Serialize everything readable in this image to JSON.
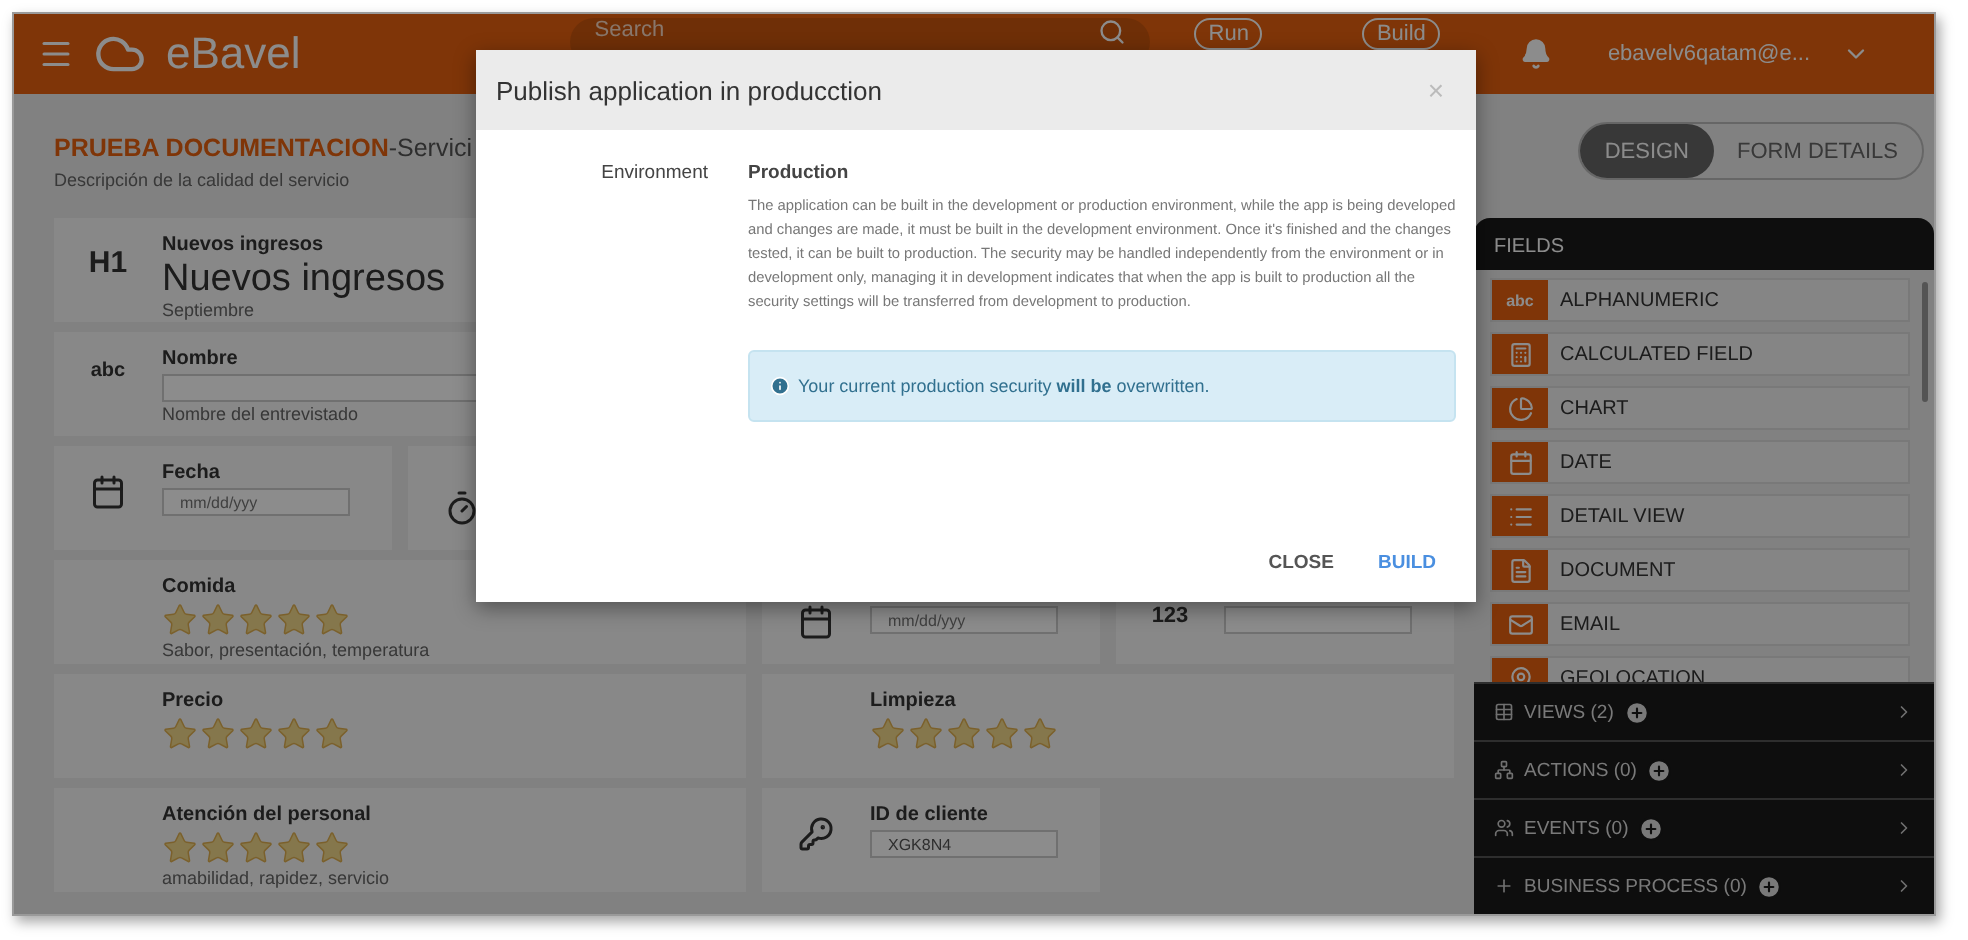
{
  "header": {
    "brand": "eBavel",
    "search": {
      "placeholder": "Search"
    },
    "buttons": [
      "Run",
      "Build"
    ],
    "user": "ebavelv6qatam@e..."
  },
  "form": {
    "title": "PRUEBA DOCUMENTACION",
    "title_suffix": "-Servici",
    "subtitle": "Descripción de la calidad del servicio",
    "fields": [
      {
        "kind": "heading",
        "label": "Nuevos ingresos",
        "value": "Nuevos ingresos",
        "hint": "Septiembre",
        "icon_text": "H1"
      },
      {
        "kind": "text",
        "label": "Nombre",
        "hint": "Nombre del entrevistado",
        "icon_text": "abc"
      },
      {
        "kind": "date",
        "label": "Fecha",
        "placeholder": "mm/dd/yyy"
      },
      {
        "kind": "time"
      },
      {
        "kind": "rating",
        "label": "Comida",
        "stars": 5,
        "hint": "Sabor, presentación, temperatura"
      },
      {
        "kind": "date",
        "placeholder": "mm/dd/yyy"
      },
      {
        "kind": "number",
        "icon_text": "123"
      },
      {
        "kind": "rating",
        "label": "Precio",
        "stars": 5
      },
      {
        "kind": "rating",
        "label": "Limpieza",
        "stars": 5
      },
      {
        "kind": "rating",
        "label": "Atención del personal",
        "stars": 5,
        "hint": "amabilidad, rapidez, servicio"
      },
      {
        "kind": "key",
        "label": "ID de cliente",
        "value": "XGK8N4"
      }
    ]
  },
  "view_tabs": [
    {
      "label": "DESIGN",
      "selected": true
    },
    {
      "label": "FORM DETAILS",
      "selected": false
    }
  ],
  "panel": {
    "title": "FIELDS",
    "field_types": [
      {
        "kind": "text",
        "label": "ALPHANUMERIC",
        "icon_text": "abc"
      },
      {
        "kind": "calculator",
        "label": "CALCULATED FIELD"
      },
      {
        "kind": "chart",
        "label": "CHART"
      },
      {
        "kind": "date",
        "label": "DATE"
      },
      {
        "kind": "detail",
        "label": "DETAIL VIEW"
      },
      {
        "kind": "document",
        "label": "DOCUMENT"
      },
      {
        "kind": "email",
        "label": "EMAIL"
      },
      {
        "kind": "location",
        "label": "GEOLOCATION"
      }
    ],
    "sections": [
      {
        "kind": "views",
        "label": "VIEWS (2)"
      },
      {
        "kind": "actions",
        "label": "ACTIONS (0)"
      },
      {
        "kind": "events",
        "label": "EVENTS (0)"
      },
      {
        "kind": "process",
        "label": "BUSINESS PROCESS (0)"
      }
    ]
  },
  "modal": {
    "title": "Publish application in producction",
    "close": "×",
    "field_label": "Environment",
    "heading": "Production",
    "description": "The application can be built in the development or production environment, while the app is being developed and changes are made, it must be built in the development environment. Once it's finished and the changes tested, it can be built to production. The security may be handled independently from the environment or in development only, managing it in development indicates that when the app is built to production all the security settings will be transferred from development to production.",
    "notice": "Your current production security **will be** overwritten.",
    "buttons": [
      {
        "kind": "secondary",
        "label": "CLOSE"
      },
      {
        "kind": "primary",
        "label": "BUILD"
      }
    ]
  }
}
